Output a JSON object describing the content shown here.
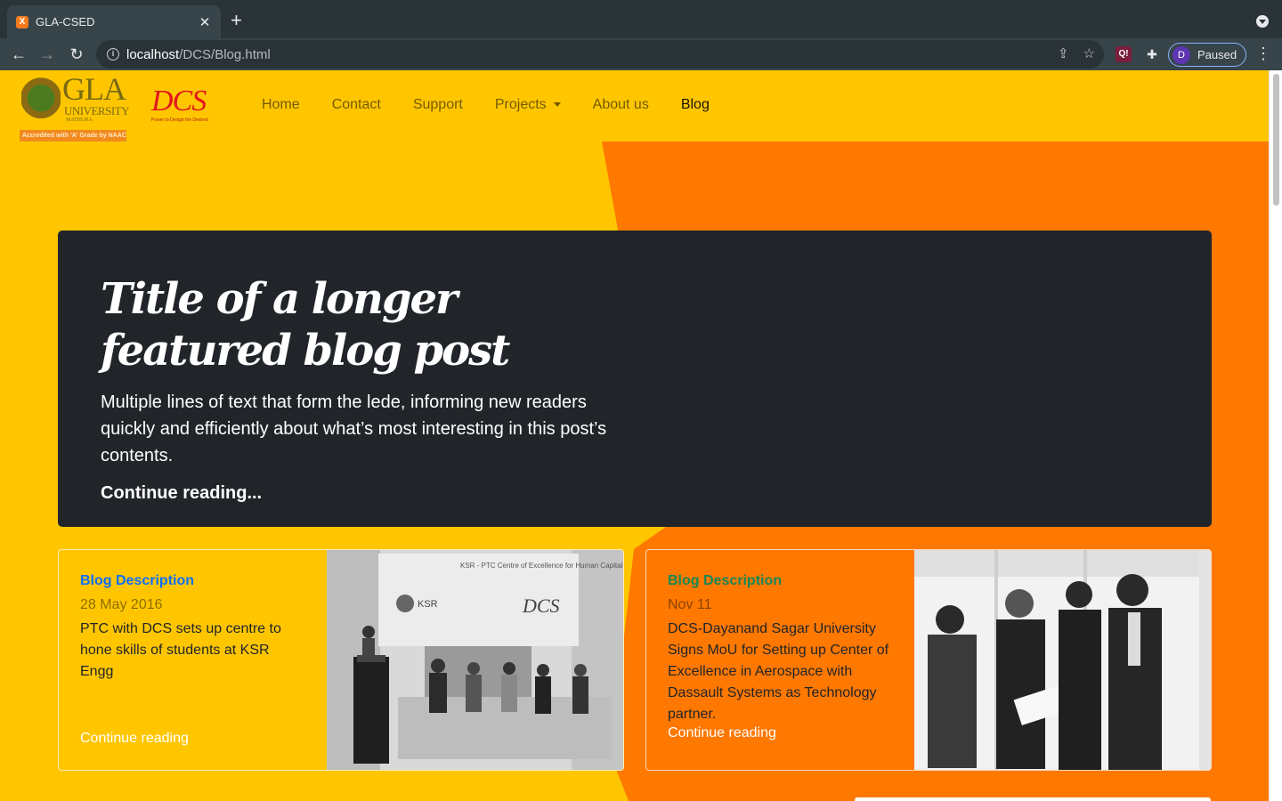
{
  "browser": {
    "tab_title": "GLA-CSED",
    "tab_favicon": "X",
    "url_host": "localhost",
    "url_path": "/DCS/Blog.html",
    "profile_initial": "D",
    "profile_status": "Paused",
    "extension_label": "Q!"
  },
  "brand": {
    "gla_word": "GLA",
    "gla_univ": "UNIVERSITY",
    "gla_city": "MATHURA",
    "gla_badge": "Accredited with 'A' Grade by NAAC",
    "dcs_word": "DCS",
    "dcs_tagline": "Power to Design the Desired"
  },
  "nav": {
    "items": [
      {
        "label": "Home"
      },
      {
        "label": "Contact"
      },
      {
        "label": "Support"
      },
      {
        "label": "Projects"
      },
      {
        "label": "About us"
      },
      {
        "label": "Blog"
      }
    ]
  },
  "hero": {
    "title": "Title of a longer featured blog post",
    "lede": "Multiple lines of text that form the lede, informing new readers quickly and efficiently about what’s most interesting in this post’s contents.",
    "link": "Continue reading..."
  },
  "cards": [
    {
      "category": "Blog Description",
      "date": "28 May 2016",
      "text": "PTC with DCS sets up centre to hone skills of students at KSR Engg",
      "link": "Continue reading",
      "image_banner_title": "KSR - PTC Centre of Excellence for Human Capital Skill Development",
      "image_banner_ksr": "KSR",
      "image_banner_dcs": "DCS"
    },
    {
      "category": "Blog Description",
      "date": "Nov 11",
      "text": "DCS-Dayanand Sagar University Signs MoU for Setting up Center of Excellence in Aerospace with Dassault Systems as Technology partner.",
      "link": "Continue reading"
    }
  ],
  "colors": {
    "page_yellow": "#ffc600",
    "page_orange": "#ff7800",
    "hero_dark": "#212529",
    "category_blue": "#0d6efd",
    "category_green": "#198754"
  }
}
